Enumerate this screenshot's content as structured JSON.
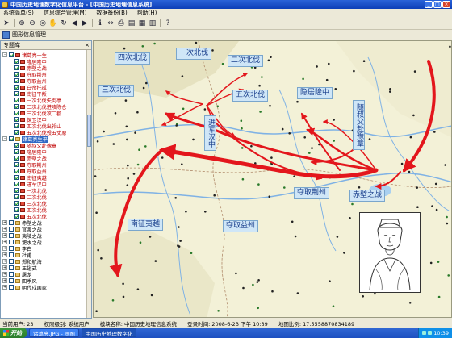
{
  "window": {
    "title": "中国历史地理数字化信息平台 - [中国历史地理信息系统]"
  },
  "menu": [
    "系统简单(S)",
    "信息综合管理(M)",
    "数据备份(B)",
    "帮助(H)"
  ],
  "toolbar_icons": [
    "select-icon",
    "zoom-in-icon",
    "zoom-out-icon",
    "full-extent-icon",
    "pan-hand-icon",
    "refresh-icon",
    "back-icon",
    "forward-icon",
    "identify-icon",
    "measure-icon",
    "print-icon",
    "layer-icon",
    "chart-icon",
    "table-icon",
    "help-icon"
  ],
  "subtoolbar": {
    "label": "图形信息管理"
  },
  "panel": {
    "title": "专题库",
    "tree": [
      {
        "level": 0,
        "label": "诸葛亮一生",
        "red": true,
        "checked": true,
        "expand": "-"
      },
      {
        "level": 1,
        "label": "隆居隆中",
        "red": true,
        "checked": true
      },
      {
        "level": 1,
        "label": "赤壁之战",
        "red": true,
        "checked": true
      },
      {
        "level": 1,
        "label": "夺取荆州",
        "red": true,
        "checked": true
      },
      {
        "level": 1,
        "label": "夺取益州",
        "red": true,
        "checked": true
      },
      {
        "level": 1,
        "label": "白帝托孤",
        "red": true,
        "checked": true
      },
      {
        "level": 1,
        "label": "南征平叛",
        "red": true,
        "checked": true
      },
      {
        "level": 1,
        "label": "一次北伐失街亭",
        "red": true,
        "checked": true
      },
      {
        "level": 1,
        "label": "二次北伐进攻陈仓",
        "red": true,
        "checked": true
      },
      {
        "level": 1,
        "label": "三次北伐攻二郡",
        "red": true,
        "checked": true
      },
      {
        "level": 1,
        "label": "保卫汉中",
        "red": true,
        "checked": true
      },
      {
        "level": 1,
        "label": "四次北伐出祁山",
        "red": true,
        "checked": true
      },
      {
        "level": 1,
        "label": "五次北伐殁五丈原",
        "red": true,
        "checked": true
      },
      {
        "level": 0,
        "label": "诸葛亮生平",
        "red": false,
        "checked": true,
        "expand": "-",
        "selected": true
      },
      {
        "level": 1,
        "label": "随叔父赴豫章",
        "red": true,
        "checked": true
      },
      {
        "level": 1,
        "label": "隐居隆中",
        "red": true,
        "checked": true
      },
      {
        "level": 1,
        "label": "赤壁之战",
        "red": true,
        "checked": true
      },
      {
        "level": 1,
        "label": "夺取荆州",
        "red": true,
        "checked": true
      },
      {
        "level": 1,
        "label": "夺取益州",
        "red": true,
        "checked": true
      },
      {
        "level": 1,
        "label": "南征夷越",
        "red": true,
        "checked": true
      },
      {
        "level": 1,
        "label": "进军汉中",
        "red": true,
        "checked": true
      },
      {
        "level": 1,
        "label": "一次北伐",
        "red": true,
        "checked": true
      },
      {
        "level": 1,
        "label": "二次北伐",
        "red": true,
        "checked": true
      },
      {
        "level": 1,
        "label": "三次北伐",
        "red": true,
        "checked": true
      },
      {
        "level": 1,
        "label": "四次北伐",
        "red": true,
        "checked": true
      },
      {
        "level": 1,
        "label": "五次北伐",
        "red": true,
        "checked": true
      },
      {
        "level": 0,
        "label": "赤壁之战",
        "red": false,
        "checked": false,
        "expand": "+"
      },
      {
        "level": 0,
        "label": "官渡之战",
        "red": false,
        "checked": false,
        "expand": "+"
      },
      {
        "level": 0,
        "label": "夷陵之战",
        "red": false,
        "checked": false,
        "expand": "+"
      },
      {
        "level": 0,
        "label": "淝水之战",
        "red": false,
        "checked": false,
        "expand": "+"
      },
      {
        "level": 0,
        "label": "李白",
        "red": false,
        "checked": false,
        "expand": "+"
      },
      {
        "level": 0,
        "label": "杜甫",
        "red": false,
        "checked": false,
        "expand": "+"
      },
      {
        "level": 0,
        "label": "郑和航海",
        "red": false,
        "checked": false,
        "expand": "+"
      },
      {
        "level": 0,
        "label": "王翅式",
        "red": false,
        "checked": false,
        "expand": "+"
      },
      {
        "level": 0,
        "label": "屠龙",
        "red": false,
        "checked": false,
        "expand": "+"
      },
      {
        "level": 0,
        "label": "四季风",
        "red": false,
        "checked": false,
        "expand": "+"
      },
      {
        "level": 0,
        "label": "明代戍国家",
        "red": false,
        "checked": false,
        "expand": "+"
      }
    ]
  },
  "map": {
    "labels": {
      "l1": "一次北伐",
      "l2": "四次北伐",
      "l3": "二次北伐",
      "l4": "三次北伐",
      "l5": "五次北伐",
      "l6": "隐居隆中",
      "l7": "随叔父赴豫章",
      "l8": "进军汉中",
      "l9": "夺取荆州",
      "l10": "赤壁之战",
      "l11": "南征夷越",
      "l12": "夺取益州"
    },
    "colors": {
      "route": "#e3161c",
      "label_bg": "#cfe6f7",
      "land": "#f3f1d7"
    }
  },
  "status": {
    "user_count": "当前用户: 23",
    "user": "权限级别: 系统用户",
    "module": "模块名称: 中国历史地理信息系统",
    "login": "登录时间: 2008-6-23 下午 10:39",
    "scale": "地图比例: 17.5558870834189"
  },
  "taskbar": {
    "start": "开始",
    "tasks": [
      "诸葛亮.JPG - 画图",
      "中国历史地理数字化"
    ],
    "clock": "10:39"
  }
}
